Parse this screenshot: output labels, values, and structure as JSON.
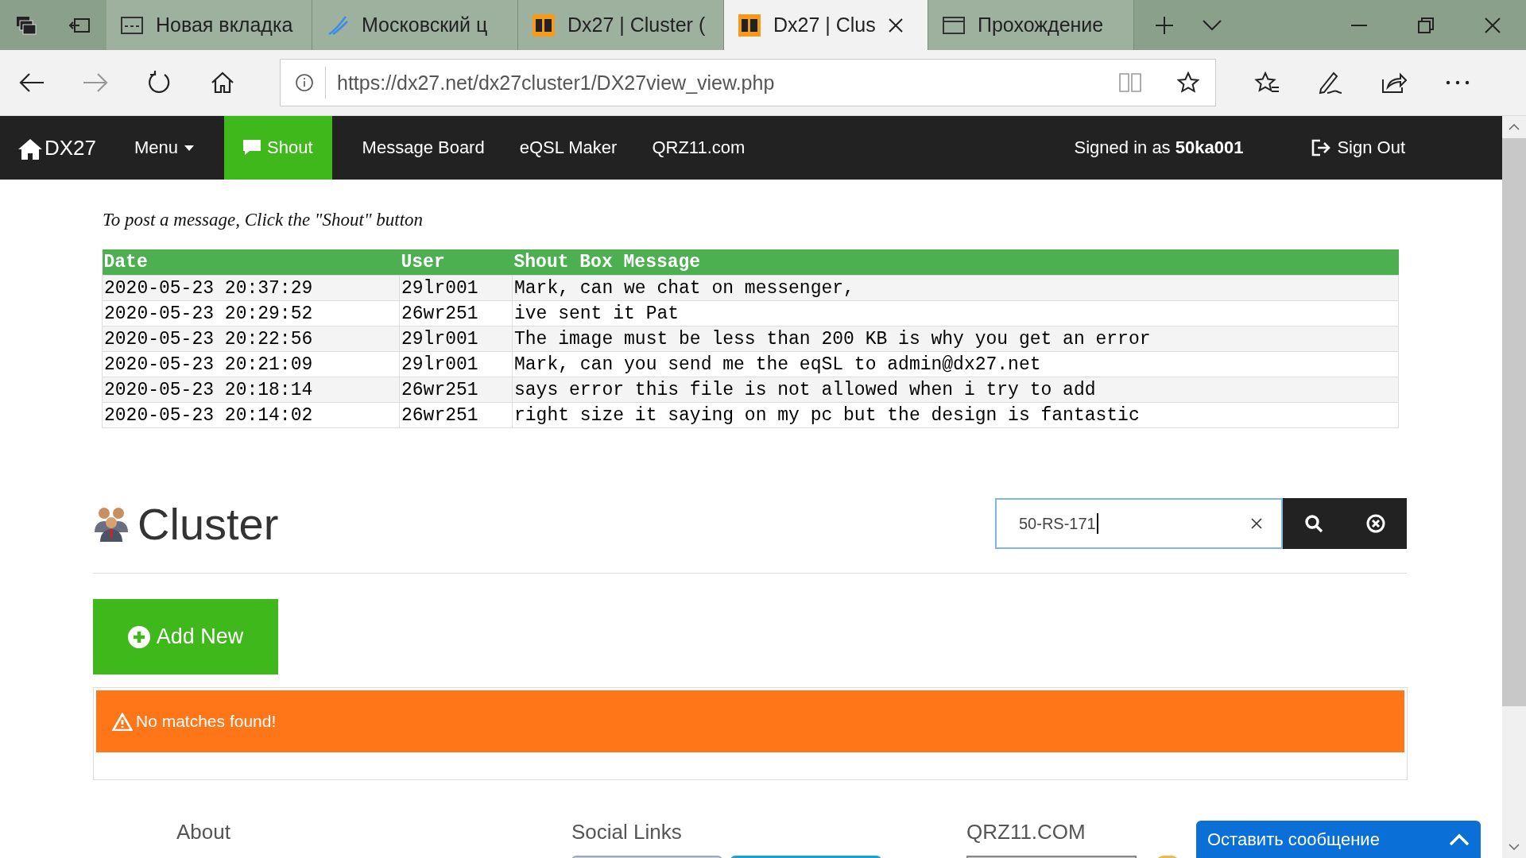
{
  "browser": {
    "tabs": [
      {
        "title": "Новая вкладка",
        "kind": "grid",
        "selected": false
      },
      {
        "title": "Московский ц",
        "kind": "swoosh",
        "selected": false
      },
      {
        "title": "Dx27 | Cluster (",
        "kind": "logo",
        "selected": false
      },
      {
        "title": "Dx27 | Clus",
        "kind": "logo",
        "selected": true
      },
      {
        "title": "Прохождение",
        "kind": "window",
        "selected": false
      }
    ],
    "url": "https://dx27.net/dx27cluster1/DX27view_view.php"
  },
  "navbar": {
    "brand": "DX27",
    "menu": "Menu",
    "items": [
      {
        "label": "Shout",
        "kind": "comment",
        "selected": true
      },
      {
        "label": "Message Board",
        "selected": false
      },
      {
        "label": "eQSL Maker",
        "selected": false
      },
      {
        "label": "QRZ11.com",
        "selected": false
      }
    ],
    "signed_in": "Signed in as **50ka001**",
    "sign_out": "Sign Out"
  },
  "notice": "To post a message, Click the \"Shout\" button",
  "shoutbox": {
    "columns": [
      "Date",
      "User",
      "Shout Box Message"
    ],
    "rows": [
      [
        "2020-05-23 20:37:29",
        "29lr001",
        "Mark, can we chat on messenger,"
      ],
      [
        "2020-05-23 20:29:52",
        "26wr251",
        "ive sent it Pat"
      ],
      [
        "2020-05-23 20:22:56",
        "29lr001",
        "The image must be less than 200 KB is why you get an error"
      ],
      [
        "2020-05-23 20:21:09",
        "29lr001",
        "Mark, can you send me the eqSL to admin@dx27.net"
      ],
      [
        "2020-05-23 20:18:14",
        "26wr251",
        "says error this file is not allowed when i try to add"
      ],
      [
        "2020-05-23 20:14:02",
        "26wr251",
        "right size it saying on my pc but the design is fantastic"
      ]
    ]
  },
  "cluster": {
    "title": "Cluster",
    "search_value": "50-RS-171",
    "add_new": "Add New",
    "alert": "No matches found!"
  },
  "footer": {
    "headings": [
      "About",
      "Social Links",
      "QRZ11.COM"
    ]
  },
  "chat_widget": {
    "label": "Оставить сообщение"
  }
}
